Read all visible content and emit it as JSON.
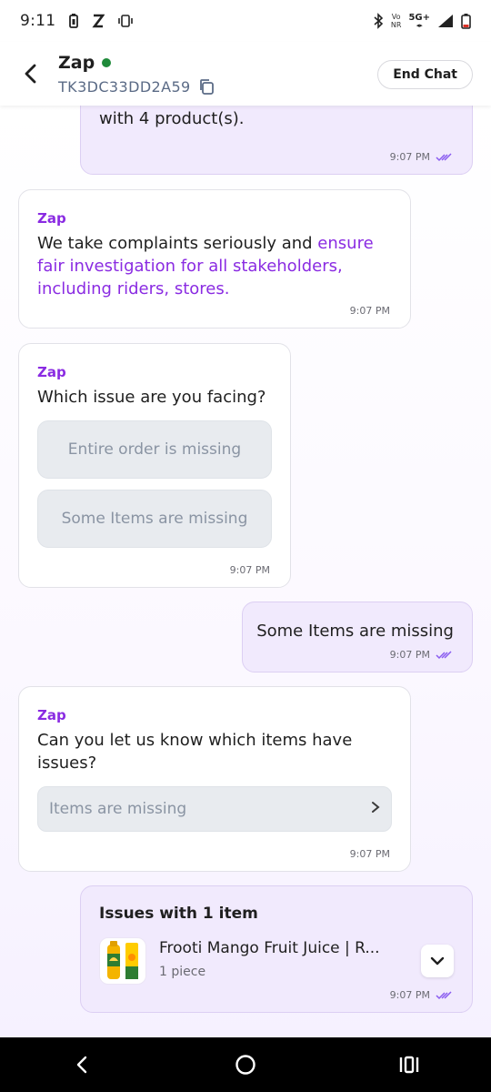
{
  "status_bar": {
    "time": "9:11",
    "network_top": "Vo",
    "network_bottom": "NR",
    "network_type": "5G+"
  },
  "header": {
    "title": "Zap",
    "ticket_id": "TK3DC33DD2A59",
    "end_chat_label": "End Chat",
    "online_color": "#1f8a3a"
  },
  "messages": {
    "m1": {
      "text": "with 4 product(s).",
      "time": "9:07 PM"
    },
    "m2": {
      "sender": "Zap",
      "text_plain": "We take complaints seriously and ",
      "text_highlight": "ensure fair investigation for all stakeholders, including riders, stores.",
      "time": "9:07 PM"
    },
    "m3": {
      "sender": "Zap",
      "text": "Which issue are you facing?",
      "options": [
        "Entire order is missing",
        "Some Items are missing"
      ],
      "time": "9:07 PM"
    },
    "m4": {
      "text": "Some Items are missing",
      "time": "9:07 PM"
    },
    "m5": {
      "sender": "Zap",
      "text": "Can you let us know which items have issues?",
      "select_label": "Items are missing",
      "time": "9:07 PM"
    },
    "m6": {
      "title": "Issues with 1 item",
      "product_name": "Frooti Mango Fruit Juice | R...",
      "quantity": "1 piece",
      "time": "9:07 PM"
    }
  },
  "colors": {
    "accent": "#8a2be2",
    "user_bubble": "#f1eafd",
    "read_tick": "#8a5cf0"
  }
}
